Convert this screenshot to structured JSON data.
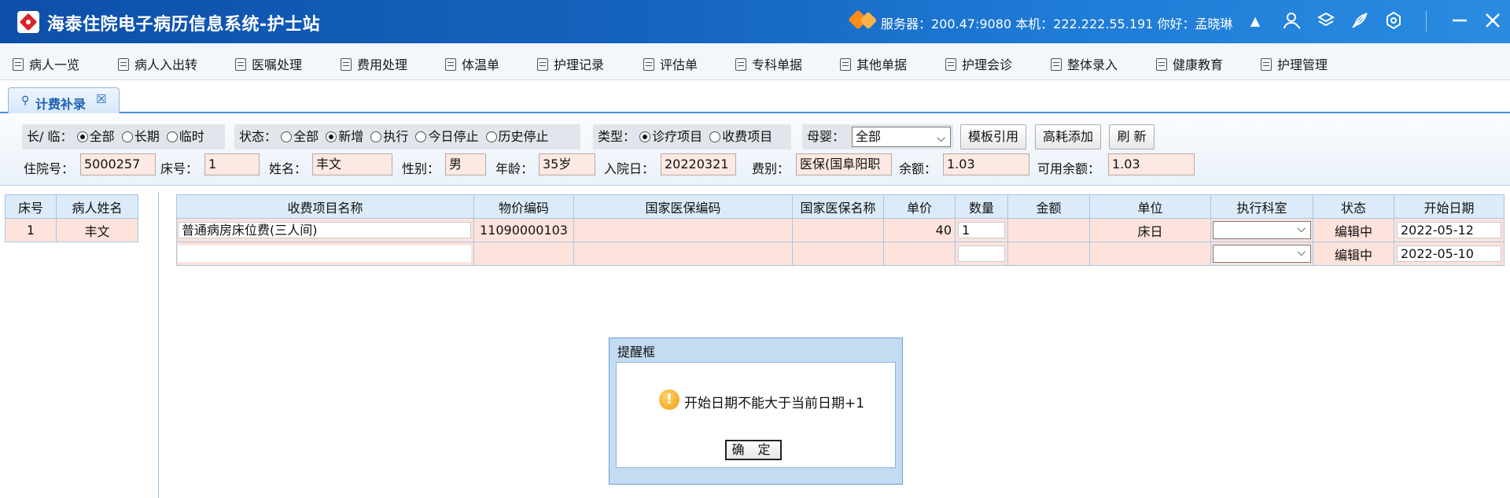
{
  "app": {
    "title": "海泰住院电子病历信息系统-护士站",
    "server_info": "服务器：200.47:9080 本机：222.222.55.191 你好：孟晓琳"
  },
  "menu": [
    {
      "label": "病人一览"
    },
    {
      "label": "病人入出转"
    },
    {
      "label": "医嘱处理"
    },
    {
      "label": "费用处理"
    },
    {
      "label": "体温单"
    },
    {
      "label": "护理记录"
    },
    {
      "label": "评估单"
    },
    {
      "label": "专科单据"
    },
    {
      "label": "其他单据"
    },
    {
      "label": "护理会诊"
    },
    {
      "label": "整体录入"
    },
    {
      "label": "健康教育"
    },
    {
      "label": "护理管理"
    }
  ],
  "tab": {
    "label": "计费补录",
    "close": "☒"
  },
  "filters": {
    "duration": {
      "label": "长/ 临：",
      "options": [
        "全部",
        "长期",
        "临时"
      ],
      "selected": "全部"
    },
    "status": {
      "label": "状态：",
      "options": [
        "全部",
        "新增",
        "执行",
        "今日停止",
        "历史停止"
      ],
      "selected": "新增"
    },
    "type": {
      "label": "类型：",
      "options": [
        "诊疗项目",
        "收费项目"
      ],
      "selected": "诊疗项目"
    },
    "mother_baby": {
      "label": "母婴：",
      "value": "全部"
    },
    "buttons": {
      "template": "模板引用",
      "high_cost": "高耗添加",
      "refresh": "刷 新"
    }
  },
  "patient": {
    "admission_no_label": "住院号：",
    "admission_no": "5000257",
    "bed_label": "床号：",
    "bed": "1",
    "name_label": "姓名：",
    "name": "丰文",
    "gender_label": "性别：",
    "gender": "男",
    "age_label": "年龄：",
    "age": "35岁",
    "admit_date_label": "入院日：",
    "admit_date": "20220321",
    "fee_type_label": "费别：",
    "fee_type": "医保(国阜阳职",
    "balance_label": "余额：",
    "balance": "1.03",
    "available_label": "可用余额：",
    "available": "1.03"
  },
  "patient_list": {
    "headers": [
      "床号",
      "病人姓名"
    ],
    "rows": [
      {
        "bed": "1",
        "name": "丰文"
      }
    ]
  },
  "charges": {
    "headers": [
      "收费项目名称",
      "物价编码",
      "国家医保编码",
      "国家医保名称",
      "单价",
      "数量",
      "金额",
      "单位",
      "执行科室",
      "状态",
      "开始日期"
    ],
    "rows": [
      {
        "name": "普通病房床位费(三人间)",
        "price_code": "11090000103",
        "ins_code": "",
        "ins_name": "",
        "unit_price": "40",
        "qty": "1",
        "amount": "",
        "unit": "床日",
        "dept": "",
        "status": "编辑中",
        "start_date": "2022-05-12"
      },
      {
        "name": "",
        "price_code": "",
        "ins_code": "",
        "ins_name": "",
        "unit_price": "",
        "qty": "",
        "amount": "",
        "unit": "",
        "dept": "",
        "status": "编辑中",
        "start_date": "2022-05-10"
      }
    ]
  },
  "dialog": {
    "title": "提醒框",
    "message": "开始日期不能大于当前日期+1",
    "ok": "确 定"
  },
  "colors": {
    "titlebar": "#1565c0",
    "grid_header": "#dcebfa",
    "row_bg": "#fde3dc",
    "accent": "#1d5fb1"
  }
}
